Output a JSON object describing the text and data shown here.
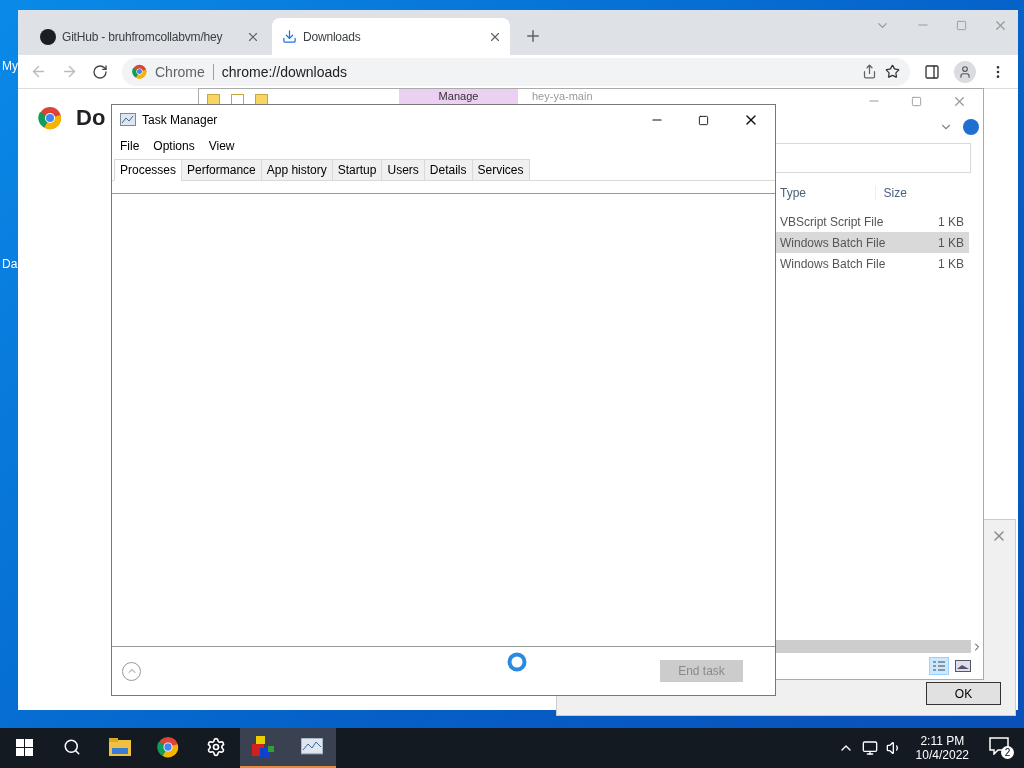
{
  "desktop": {
    "icons": [
      {
        "label": "My"
      },
      {
        "label": "Da"
      }
    ]
  },
  "browser": {
    "tabs": [
      {
        "title": "GitHub - bruhfromcollabvm/hey",
        "kind": "github",
        "selected": false
      },
      {
        "title": "Downloads",
        "kind": "download",
        "selected": true
      }
    ],
    "omnibox": {
      "chip": "Chrome",
      "url": "chrome://downloads"
    },
    "page_heading": "Do"
  },
  "explorer": {
    "ribbon_tab": "Manage",
    "title": "hey-ya-main",
    "columns": [
      "Type",
      "Size"
    ],
    "rows": [
      {
        "type": "VBScript Script File",
        "size": "1 KB",
        "selected": false
      },
      {
        "type": "Windows Batch File",
        "size": "1 KB",
        "selected": true
      },
      {
        "type": "Windows Batch File",
        "size": "1 KB",
        "selected": false
      }
    ]
  },
  "dialog": {
    "button": "OK"
  },
  "task_manager": {
    "title": "Task Manager",
    "menu": [
      "File",
      "Options",
      "View"
    ],
    "tabs": [
      {
        "label": "Processes",
        "selected": true
      },
      {
        "label": "Performance",
        "selected": false
      },
      {
        "label": "App history",
        "selected": false
      },
      {
        "label": "Startup",
        "selected": false
      },
      {
        "label": "Users",
        "selected": false
      },
      {
        "label": "Details",
        "selected": false
      },
      {
        "label": "Services",
        "selected": false
      }
    ],
    "end_task": {
      "label": "End task",
      "disabled": true
    }
  },
  "taskbar": {
    "apps": [
      {
        "kind": "folder",
        "active": false
      },
      {
        "kind": "chrome",
        "active": false
      },
      {
        "kind": "settings",
        "active": false
      },
      {
        "kind": "blocks",
        "active": true
      },
      {
        "kind": "monitor",
        "active": true
      }
    ],
    "time": "2:11 PM",
    "date": "10/4/2022",
    "notifications": "2"
  }
}
